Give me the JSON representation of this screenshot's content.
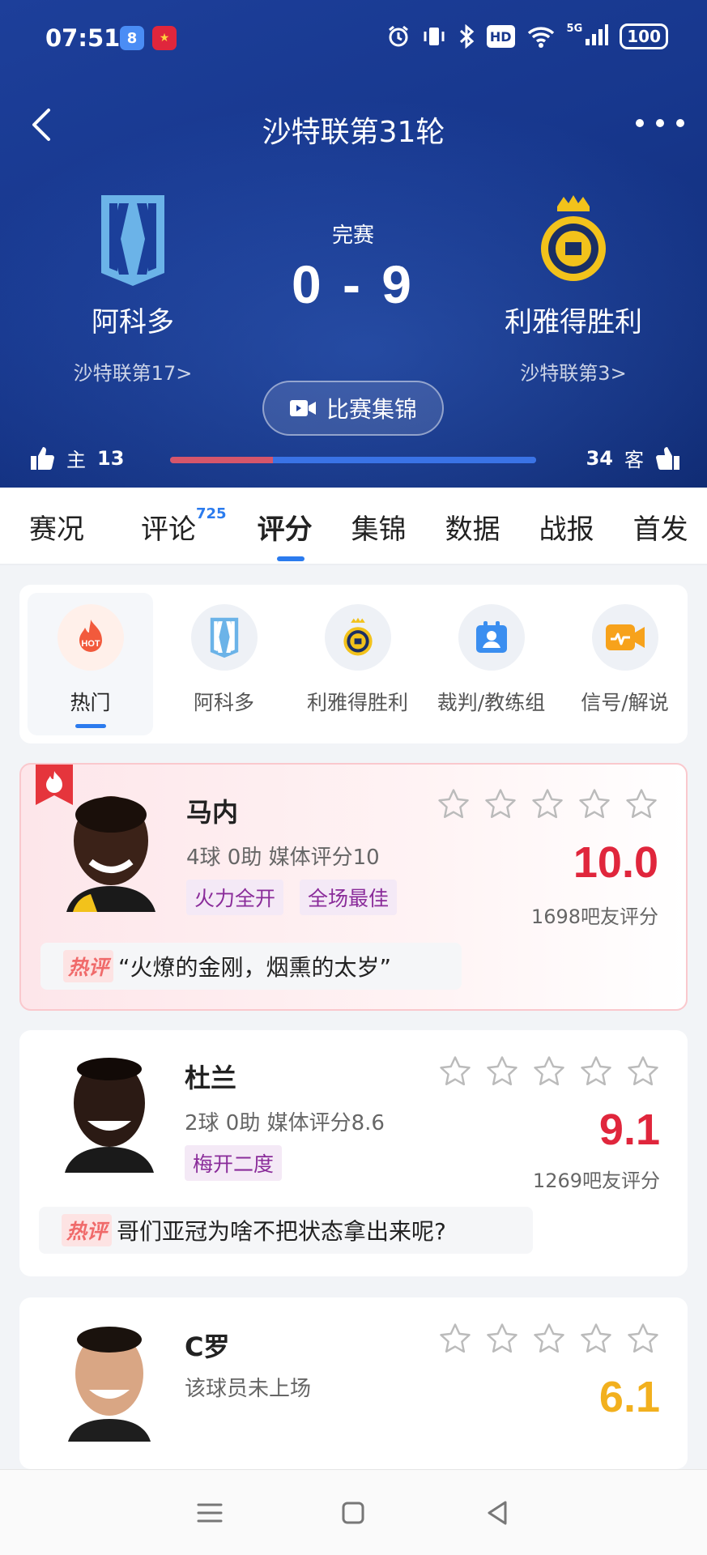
{
  "status_bar": {
    "time": "07:51",
    "app1": "8",
    "battery": "100",
    "signal": "5G",
    "hd": "HD"
  },
  "header": {
    "title": "沙特联第31轮"
  },
  "match": {
    "status": "完赛",
    "score": "0 - 9",
    "home": {
      "name": "阿科多",
      "rank": "沙特联第17>"
    },
    "away": {
      "name": "利雅得胜利",
      "rank": "沙特联第3>"
    },
    "highlight_label": "比赛集锦"
  },
  "votes": {
    "home_label": "主",
    "home_count": "13",
    "away_label": "客",
    "away_count": "34",
    "home_share": 0.28
  },
  "tabs": [
    {
      "label": "赛况"
    },
    {
      "label": "评论",
      "badge": "725"
    },
    {
      "label": "评分"
    },
    {
      "label": "集锦"
    },
    {
      "label": "数据"
    },
    {
      "label": "战报"
    },
    {
      "label": "首发"
    }
  ],
  "filters": [
    {
      "label": "热门",
      "icon": "HOT"
    },
    {
      "label": "阿科多"
    },
    {
      "label": "利雅得胜利"
    },
    {
      "label": "裁判/教练组"
    },
    {
      "label": "信号/解说"
    }
  ],
  "players": [
    {
      "name": "马内",
      "stats": "4球 0助  媒体评分10",
      "tags": [
        "火力全开",
        "全场最佳"
      ],
      "rating": "10.0",
      "rating_color": "#e0263c",
      "count": "1698吧友评分",
      "comment_tag": "热评",
      "comment": "“火燎的金刚，烟熏的太岁”"
    },
    {
      "name": "杜兰",
      "stats": "2球 0助  媒体评分8.6",
      "tags": [
        "梅开二度"
      ],
      "rating": "9.1",
      "rating_color": "#e0263c",
      "count": "1269吧友评分",
      "comment_tag": "热评",
      "comment": "哥们亚冠为啥不把状态拿出来呢?"
    },
    {
      "name": "C罗",
      "stats": "该球员未上场",
      "rating": "6.1",
      "rating_color": "#f2b01e"
    }
  ],
  "colors": {
    "accent": "#2b7bee",
    "header_bg": "#17378d",
    "hot": "#e0263c"
  }
}
